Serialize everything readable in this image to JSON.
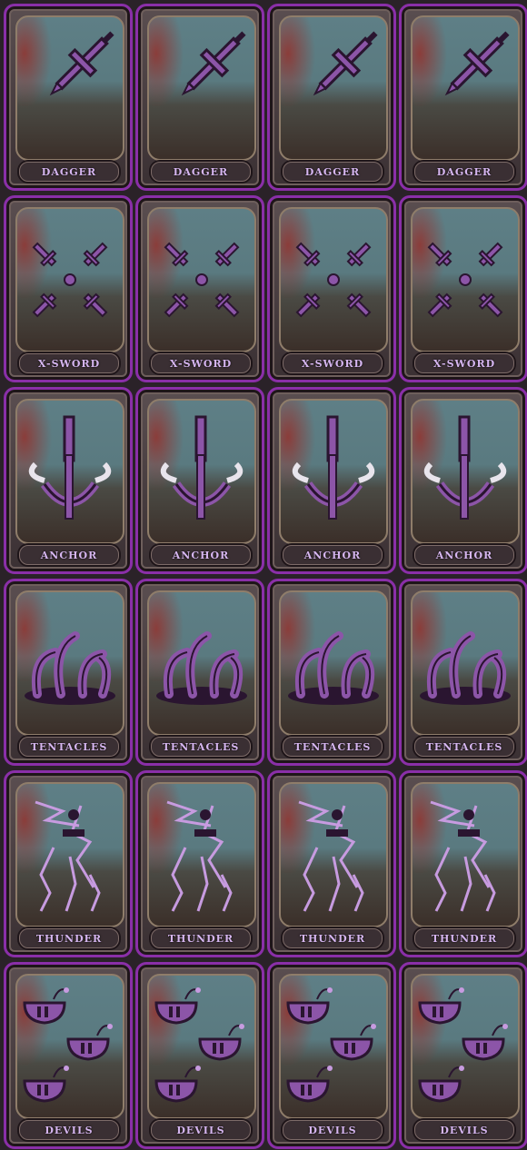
{
  "cards": [
    {
      "label": "DAGGER",
      "icon": "dagger-icon"
    },
    {
      "label": "X-SWORD",
      "icon": "x-sword-icon"
    },
    {
      "label": "ANCHOR",
      "icon": "anchor-icon"
    },
    {
      "label": "TENTACLES",
      "icon": "tentacles-icon"
    },
    {
      "label": "THUNDER",
      "icon": "thunder-icon"
    },
    {
      "label": "DEVILS",
      "icon": "devils-icon"
    }
  ],
  "colors": {
    "frame_accent": "#8a2fa8",
    "icon_purple": "#8c55a8",
    "icon_dark": "#2a1530",
    "label": "#d6b6f0"
  }
}
